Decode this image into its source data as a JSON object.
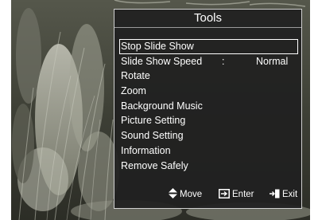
{
  "tools": {
    "title": "Tools",
    "items": [
      {
        "label": "Stop Slide Show",
        "selected": true
      },
      {
        "label": "Slide Show Speed",
        "separator": ":",
        "value": "Normal"
      },
      {
        "label": "Rotate"
      },
      {
        "label": "Zoom"
      },
      {
        "label": "Background Music"
      },
      {
        "label": "Picture Setting"
      },
      {
        "label": "Sound Setting"
      },
      {
        "label": "Information"
      },
      {
        "label": "Remove Safely"
      }
    ]
  },
  "footer": {
    "move_label": "Move",
    "move_icon": "up-down-arrows-icon",
    "enter_label": "Enter",
    "enter_icon": "enter-icon",
    "exit_label": "Exit",
    "exit_icon": "exit-icon"
  },
  "colors": {
    "panel_bg": "#202020",
    "panel_border": "#d0d0d0",
    "text": "#ffffff"
  }
}
